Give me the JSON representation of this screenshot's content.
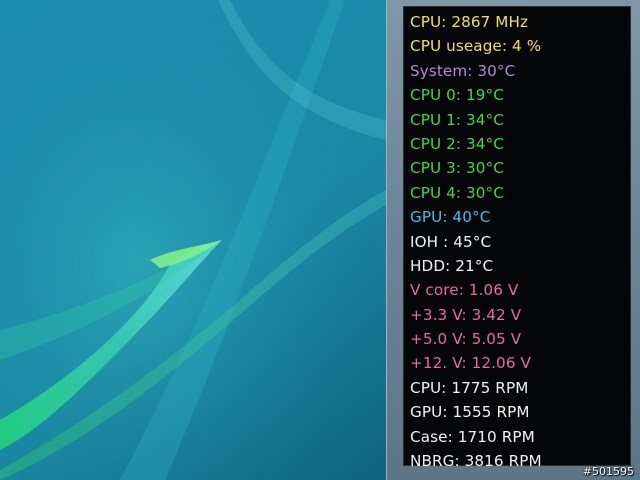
{
  "colors": {
    "yellow": "#f2e24a",
    "purple": "#b48ad8",
    "green": "#3ed84a",
    "cyan": "#36c6ea",
    "white": "#f2f2f2",
    "pink": "#e66aa4"
  },
  "monitor": {
    "rows": [
      {
        "text": "CPU: 2867 MHz",
        "color": "#f2e24a"
      },
      {
        "text": "CPU useage: 4 %",
        "color": "#f2e24a"
      },
      {
        "text": "System: 30°C",
        "color": "#b48ad8"
      },
      {
        "text": "CPU 0: 19°C",
        "color": "#3ed84a"
      },
      {
        "text": "CPU 1: 34°C",
        "color": "#3ed84a"
      },
      {
        "text": "CPU 2: 34°C",
        "color": "#3ed84a"
      },
      {
        "text": "CPU 3: 30°C",
        "color": "#3ed84a"
      },
      {
        "text": "CPU 4: 30°C",
        "color": "#3ed84a"
      },
      {
        "text": "GPU: 40°C",
        "color": "#36c6ea"
      },
      {
        "text": "IOH : 45°C",
        "color": "#f2f2f2"
      },
      {
        "text": "HDD: 21°C",
        "color": "#f2f2f2"
      },
      {
        "text": "V core: 1.06 V",
        "color": "#e66aa4"
      },
      {
        "text": "+3.3 V: 3.42 V",
        "color": "#e66aa4"
      },
      {
        "text": "+5.0 V: 5.05 V",
        "color": "#e66aa4"
      },
      {
        "text": "+12. V: 12.06 V",
        "color": "#e66aa4"
      },
      {
        "text": "CPU: 1775 RPM",
        "color": "#f2f2f2"
      },
      {
        "text": "GPU: 1555 RPM",
        "color": "#f2f2f2"
      },
      {
        "text": "Case: 1710 RPM",
        "color": "#f2f2f2"
      },
      {
        "text": "NBRG: 3816 RPM",
        "color": "#f2f2f2"
      }
    ]
  },
  "watermark": "#501595"
}
